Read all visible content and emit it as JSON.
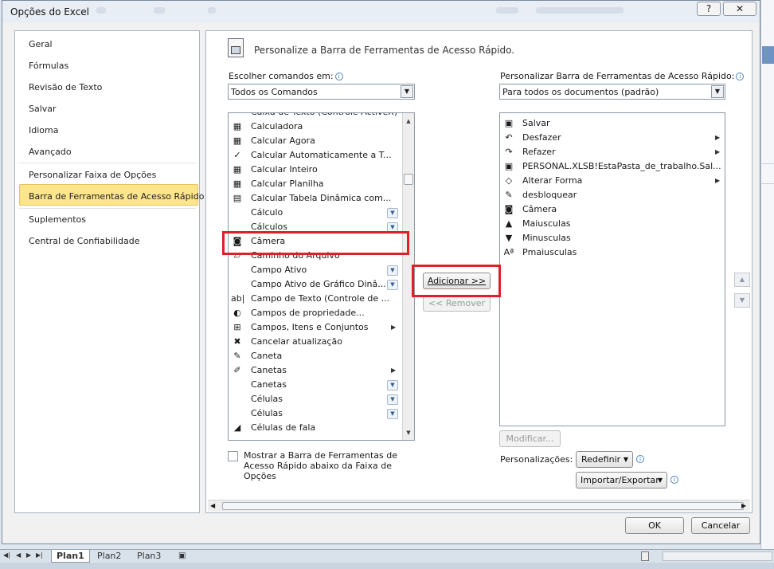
{
  "dialog": {
    "title": "Opções do Excel",
    "help_label": "?",
    "close_label": "✕"
  },
  "nav": {
    "items": [
      "Geral",
      "Fórmulas",
      "Revisão de Texto",
      "Salvar",
      "Idioma",
      "Avançado",
      "Personalizar Faixa de Opções",
      "Barra de Ferramentas de Acesso Rápido",
      "Suplementos",
      "Central de Confiabilidade"
    ],
    "selected": "Barra de Ferramentas de Acesso Rápido"
  },
  "main": {
    "heading": "Personalize a Barra de Ferramentas de Acesso Rápido.",
    "choose_label": "Escolher comandos em:",
    "choose_value": "Todos os Comandos",
    "customize_label": "Personalizar Barra de Ferramentas de Acesso Rápido:",
    "customize_value": "Para todos os documentos (padrão)",
    "commands": [
      {
        "label": "Caixa de Texto (Controle ActiveX)",
        "icon": "textbox-icon",
        "glyph": "",
        "sub": false,
        "arrow": false
      },
      {
        "label": "Calculadora",
        "icon": "calculator-icon",
        "glyph": "▦",
        "sub": false,
        "arrow": false
      },
      {
        "label": "Calcular Agora",
        "icon": "calculator-icon",
        "glyph": "▦",
        "sub": false,
        "arrow": false
      },
      {
        "label": "Calcular Automaticamente a T...",
        "icon": "checkmark-icon",
        "glyph": "✓",
        "sub": false,
        "arrow": false
      },
      {
        "label": "Calcular Inteiro",
        "icon": "calculator-icon",
        "glyph": "▦",
        "sub": false,
        "arrow": false
      },
      {
        "label": "Calcular Planilha",
        "icon": "calculator-icon",
        "glyph": "▦",
        "sub": false,
        "arrow": false
      },
      {
        "label": "Calcular Tabela Dinâmica com...",
        "icon": "pivot-table-icon",
        "glyph": "▤",
        "sub": false,
        "arrow": false
      },
      {
        "label": "Cálculo",
        "icon": "blank-icon",
        "glyph": "",
        "sub": true,
        "arrow": false
      },
      {
        "label": "Cálculos",
        "icon": "blank-icon",
        "glyph": "",
        "sub": true,
        "arrow": false
      },
      {
        "label": "Câmera",
        "icon": "camera-icon",
        "glyph": "◙",
        "sub": false,
        "arrow": false
      },
      {
        "label": "Caminho do Arquivo",
        "icon": "folder-icon",
        "glyph": "▱",
        "sub": false,
        "arrow": false
      },
      {
        "label": "Campo Ativo",
        "icon": "blank-icon",
        "glyph": "",
        "sub": true,
        "arrow": false
      },
      {
        "label": "Campo Ativo de Gráfico Dinâ...",
        "icon": "blank-icon",
        "glyph": "",
        "sub": true,
        "arrow": false
      },
      {
        "label": "Campo de Texto (Controle de ...",
        "icon": "text-field-icon",
        "glyph": "ab|",
        "sub": false,
        "arrow": false
      },
      {
        "label": "Campos de propriedade...",
        "icon": "property-fields-icon",
        "glyph": "◐",
        "sub": false,
        "arrow": false
      },
      {
        "label": "Campos, Itens e Conjuntos",
        "icon": "fields-items-icon",
        "glyph": "⊞",
        "sub": false,
        "arrow": true
      },
      {
        "label": "Cancelar atualização",
        "icon": "cancel-refresh-icon",
        "glyph": "✖",
        "sub": false,
        "arrow": false
      },
      {
        "label": "Caneta",
        "icon": "pen-icon",
        "glyph": "✎",
        "sub": false,
        "arrow": false
      },
      {
        "label": "Canetas",
        "icon": "pens-icon",
        "glyph": "✐",
        "sub": false,
        "arrow": true
      },
      {
        "label": "Canetas",
        "icon": "blank-icon",
        "glyph": "",
        "sub": true,
        "arrow": false
      },
      {
        "label": "Células",
        "icon": "blank-icon",
        "glyph": "",
        "sub": true,
        "arrow": false
      },
      {
        "label": "Células",
        "icon": "blank-icon",
        "glyph": "",
        "sub": true,
        "arrow": false
      },
      {
        "label": "Células de fala",
        "icon": "speak-cells-icon",
        "glyph": "◢",
        "sub": false,
        "arrow": false
      }
    ],
    "toolbar_items": [
      {
        "label": "Salvar",
        "icon": "save-icon",
        "glyph": "▣",
        "arrow": false
      },
      {
        "label": "Desfazer",
        "icon": "undo-icon",
        "glyph": "↶",
        "arrow": true
      },
      {
        "label": "Refazer",
        "icon": "redo-icon",
        "glyph": "↷",
        "arrow": true
      },
      {
        "label": "PERSONAL.XLSB!EstaPasta_de_trabalho.Sal...",
        "icon": "macro-icon",
        "glyph": "▣",
        "arrow": false
      },
      {
        "label": "Alterar Forma",
        "icon": "shape-icon",
        "glyph": "◇",
        "arrow": true
      },
      {
        "label": "desbloquear",
        "icon": "unlock-icon",
        "glyph": "✎",
        "arrow": false
      },
      {
        "label": "Câmera",
        "icon": "camera-icon",
        "glyph": "◙",
        "arrow": false
      },
      {
        "label": "Maiusculas",
        "icon": "triangle-up-icon",
        "glyph": "▲",
        "arrow": false
      },
      {
        "label": "Minusculas",
        "icon": "triangle-down-icon",
        "glyph": "▼",
        "arrow": false
      },
      {
        "label": "Pmaiusculas",
        "icon": "change-case-icon",
        "glyph": "Aª",
        "arrow": false
      }
    ],
    "add_label": "Adicionar >>",
    "remove_label": "<< Remover",
    "modify_label": "Modificar...",
    "customizations_label": "Personalizações:",
    "reset_label": "Redefinir",
    "import_export_label": "Importar/Exportar",
    "show_below_label": "Mostrar a Barra de Ferramentas de Acesso Rápido abaixo da Faixa de Opções"
  },
  "footer": {
    "ok_label": "OK",
    "cancel_label": "Cancelar"
  },
  "sheets": {
    "tabs": [
      "Plan1",
      "Plan2",
      "Plan3"
    ],
    "active": "Plan1"
  },
  "colors": {
    "highlight": "#e11f26",
    "nav_selected": "#fde58c"
  }
}
